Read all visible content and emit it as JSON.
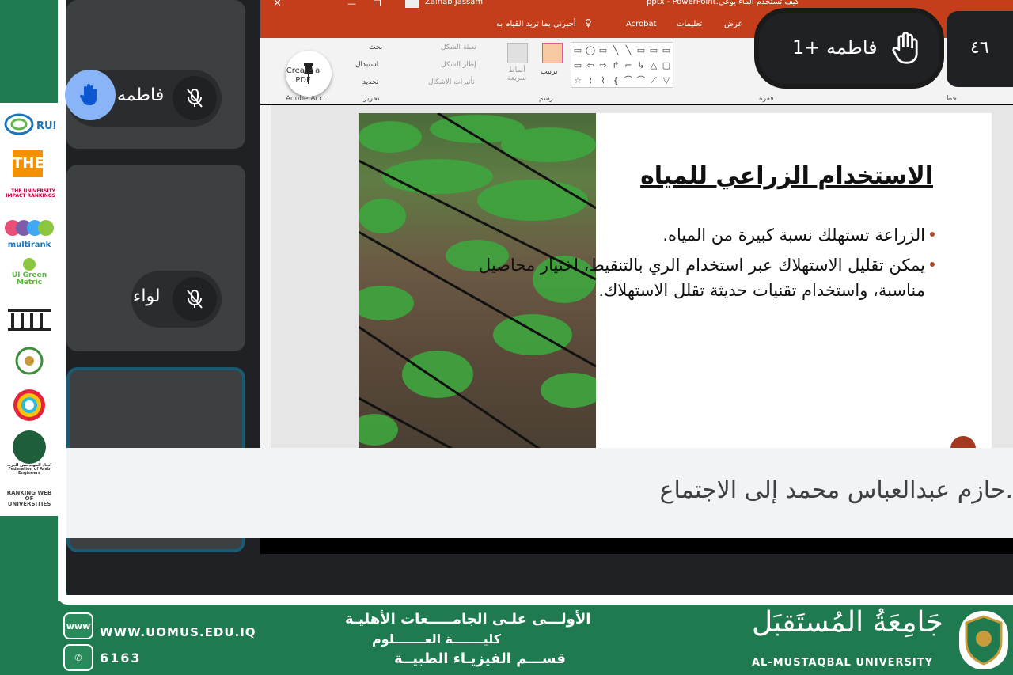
{
  "participants": {
    "tile1_name": "فاطمه",
    "tile2_name": "لواء"
  },
  "hand_raise": {
    "label": "فاطمه +1",
    "count": "٤٦"
  },
  "ppt": {
    "window_title": "كيف تستخدم الماء بوعي.pptx - PowerPoint",
    "user": "Zainab Jassam",
    "tabs": [
      "عرض",
      "تعليمات",
      "Acrobat",
      "أخبرني بما تريد القيام به"
    ],
    "ribbon": {
      "create_pdf": "Create a PDF",
      "adobe_group": "Adobe Acr...",
      "edit_group": "تحرير",
      "find": "بحث",
      "replace": "استبدال",
      "select": "تحديد",
      "drawing_group": "رسم",
      "arrange": "ترتيب",
      "quick_styles": "أنماط سريعة",
      "shape_fill": "تعبئة الشكل",
      "shape_outline": "إطار الشكل",
      "shape_effects": "تأثيرات الأشكال",
      "paragraph_group": "فقرة",
      "font_group": "خط"
    }
  },
  "slide": {
    "title": "الاستخدام الزراعي للمياه",
    "bullets": [
      "الزراعة تستهلك نسبة كبيرة من المياه.",
      "يمكن تقليل الاستهلاك عبر استخدام الري بالتنقيط، اختيار محاصيل مناسبة، واستخدام تقنيات حديثة تقلل الاستهلاك."
    ]
  },
  "notification": {
    "text": "حازم عبدالعباس محمد إلى الاجتماع."
  },
  "sidebar_logos": [
    "RUR",
    "THE",
    "THE UNIVERSITY IMPACT RANKINGS",
    "multirank",
    "UI Green Metric",
    "World University Rankings",
    "اتحاد المهندسين العرب",
    "Federation of Arab Engineers",
    "RANKING WEB OF UNIVERSITIES"
  ],
  "footer": {
    "website": "WWW.UOMUS.EDU.IQ",
    "phone": "6163",
    "line1": "الأولـــى علـى الجامـــــعات الأهليـة",
    "line2": "كليـــــــة العـــــــلوم",
    "line3": "قســـم الفيزيـاء الطبيــة",
    "university_ar": "جَامِعَةُ المُستَقبَل",
    "university_en": "AL-MUSTAQBAL UNIVERSITY",
    "www_icon_label": "www"
  },
  "colors": {
    "brand_green": "#1f7a4f",
    "ppt_orange": "#c43e1c",
    "hand_blue": "#8ab4f8",
    "meet_dark": "#202124"
  }
}
